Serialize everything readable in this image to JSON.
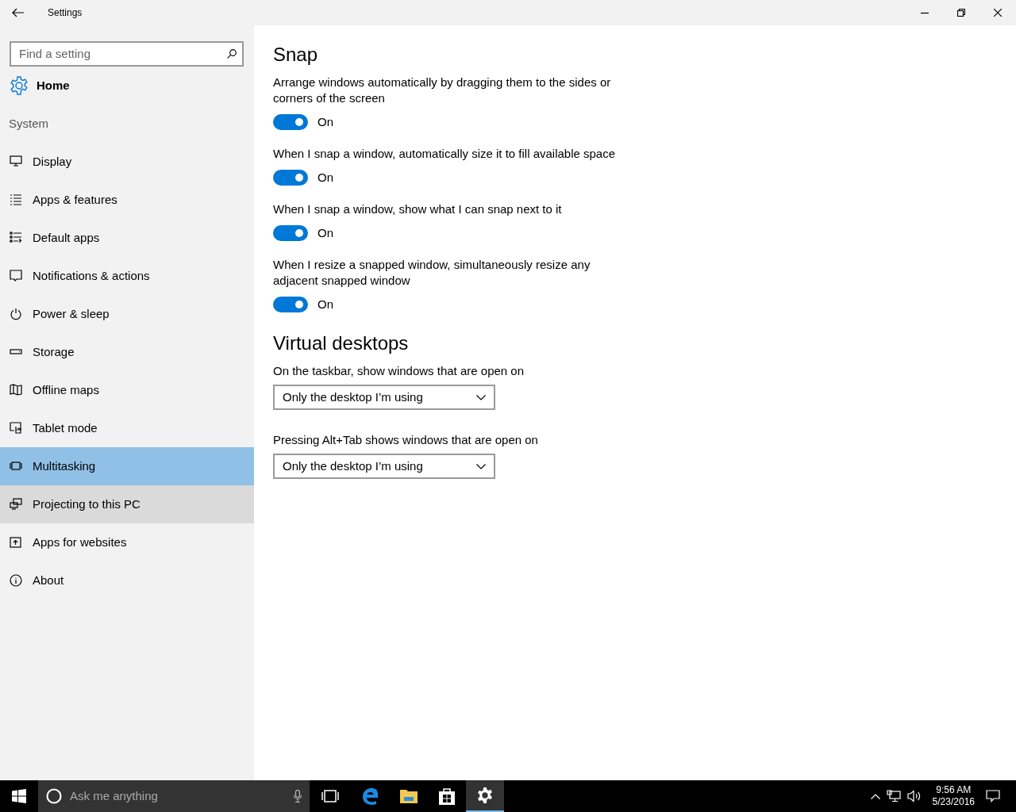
{
  "window": {
    "title": "Settings"
  },
  "sidebar": {
    "search": {
      "placeholder": "Find a setting"
    },
    "home": "Home",
    "section": "System",
    "items": [
      {
        "label": "Display",
        "selected": false,
        "hovered": false
      },
      {
        "label": "Apps & features",
        "selected": false,
        "hovered": false
      },
      {
        "label": "Default apps",
        "selected": false,
        "hovered": false
      },
      {
        "label": "Notifications & actions",
        "selected": false,
        "hovered": false
      },
      {
        "label": "Power & sleep",
        "selected": false,
        "hovered": false
      },
      {
        "label": "Storage",
        "selected": false,
        "hovered": false
      },
      {
        "label": "Offline maps",
        "selected": false,
        "hovered": false
      },
      {
        "label": "Tablet mode",
        "selected": false,
        "hovered": false
      },
      {
        "label": "Multitasking",
        "selected": true,
        "hovered": false
      },
      {
        "label": "Projecting to this PC",
        "selected": false,
        "hovered": true
      },
      {
        "label": "Apps for websites",
        "selected": false,
        "hovered": false
      },
      {
        "label": "About",
        "selected": false,
        "hovered": false
      }
    ]
  },
  "sections": [
    {
      "heading": "Snap",
      "settings": [
        {
          "kind": "toggle",
          "label": "Arrange windows automatically by dragging them to the sides or corners of the screen",
          "on": true,
          "state_text": "On"
        },
        {
          "kind": "toggle",
          "label": "When I snap a window, automatically size it to fill available space",
          "on": true,
          "state_text": "On"
        },
        {
          "kind": "toggle",
          "label": "When I snap a window, show what I can snap next to it",
          "on": true,
          "state_text": "On"
        },
        {
          "kind": "toggle",
          "label": "When I resize a snapped window, simultaneously resize any adjacent snapped window",
          "on": true,
          "state_text": "On"
        }
      ]
    },
    {
      "heading": "Virtual desktops",
      "settings": [
        {
          "kind": "dropdown",
          "label": "On the taskbar, show windows that are open on",
          "value": "Only the desktop I’m using"
        },
        {
          "kind": "dropdown",
          "label": "Pressing Alt+Tab shows windows that are open on",
          "value": "Only the desktop I’m using"
        }
      ]
    }
  ],
  "taskbar": {
    "search": {
      "placeholder": "Ask me anything"
    },
    "apps": [
      {
        "selected": false
      },
      {
        "selected": false
      },
      {
        "selected": false
      },
      {
        "selected": false
      },
      {
        "selected": true
      }
    ],
    "time": "9:56 AM",
    "date": "5/23/2016"
  }
}
